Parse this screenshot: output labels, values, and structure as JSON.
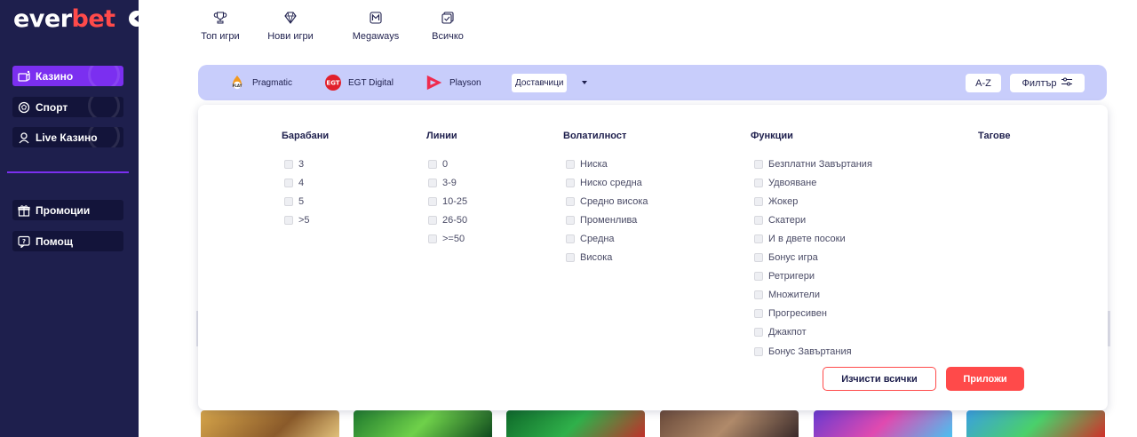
{
  "sidebar": {
    "logo": {
      "part1": "ever",
      "part2": "bet"
    },
    "items": [
      {
        "label": "Казино",
        "icon": "casino-icon"
      },
      {
        "label": "Спорт",
        "icon": "sport-icon"
      },
      {
        "label": "Live Казино",
        "icon": "live-icon"
      },
      {
        "label": "Промоции",
        "icon": "gift-icon"
      },
      {
        "label": "Помощ",
        "icon": "help-icon"
      }
    ]
  },
  "categories": [
    {
      "label": "Топ игри",
      "icon": "trophy-icon"
    },
    {
      "label": "Нови игри",
      "icon": "diamond-icon"
    },
    {
      "label": "Megaways",
      "icon": "megaways-icon"
    },
    {
      "label": "Всичко",
      "icon": "all-games-icon"
    }
  ],
  "providers": {
    "items": [
      {
        "label": "Pragmatic",
        "icon": "pragmatic-play-logo"
      },
      {
        "label": "EGT Digital",
        "icon": "egt-logo"
      },
      {
        "label": "Playson",
        "icon": "playson-logo"
      }
    ],
    "suppliers_label": "Доставчици",
    "sort_label": "A-Z",
    "filter_label": "Филтър"
  },
  "filters": {
    "reels": {
      "title": "Барабани",
      "options": [
        "3",
        "4",
        "5",
        ">5"
      ]
    },
    "lines": {
      "title": "Линии",
      "options": [
        "0",
        "3-9",
        "10-25",
        "26-50",
        ">=50"
      ]
    },
    "volatility": {
      "title": "Волатилност",
      "options": [
        "Ниска",
        "Ниско средна",
        "Средно висока",
        "Променлива",
        "Средна",
        "Висока"
      ]
    },
    "features": {
      "title": "Функции",
      "options": [
        "Безплатни Завъртания",
        "Удвояване",
        "Жокер",
        "Скатери",
        "И в двете посоки",
        "Бонус игра",
        "Ретригери",
        "Множители",
        "Прогресивен",
        "Джакпот",
        "Бонус Завъртания"
      ]
    },
    "tags": {
      "title": "Тагове"
    },
    "clear_label": "Изчисти всички",
    "apply_label": "Приложи"
  },
  "colors": {
    "sidebar_bg": "#1e1f4d",
    "accent_purple": "#7b2ff0",
    "accent_red": "#ff4a4a",
    "provider_bar_bg": "#c8cdfb"
  }
}
